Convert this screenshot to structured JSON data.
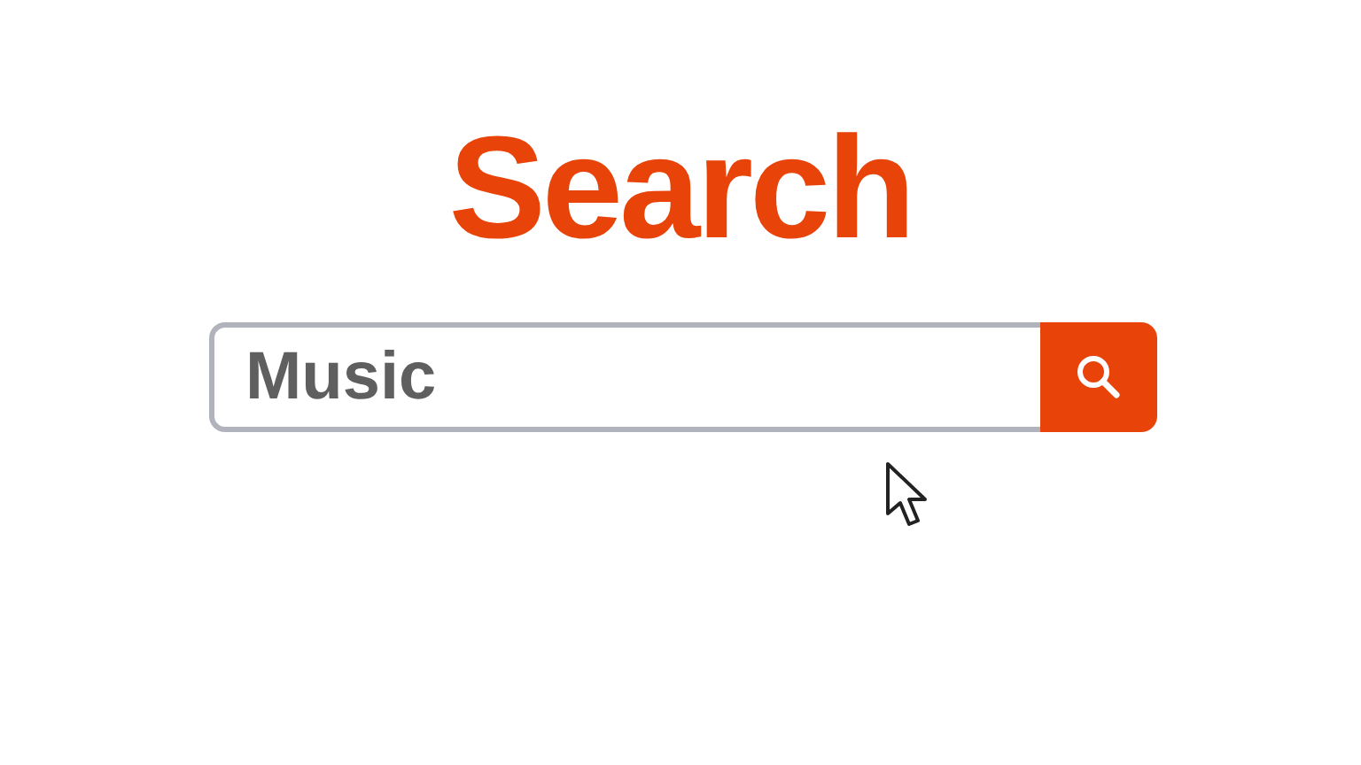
{
  "title": "Search",
  "search": {
    "value": "Music"
  }
}
